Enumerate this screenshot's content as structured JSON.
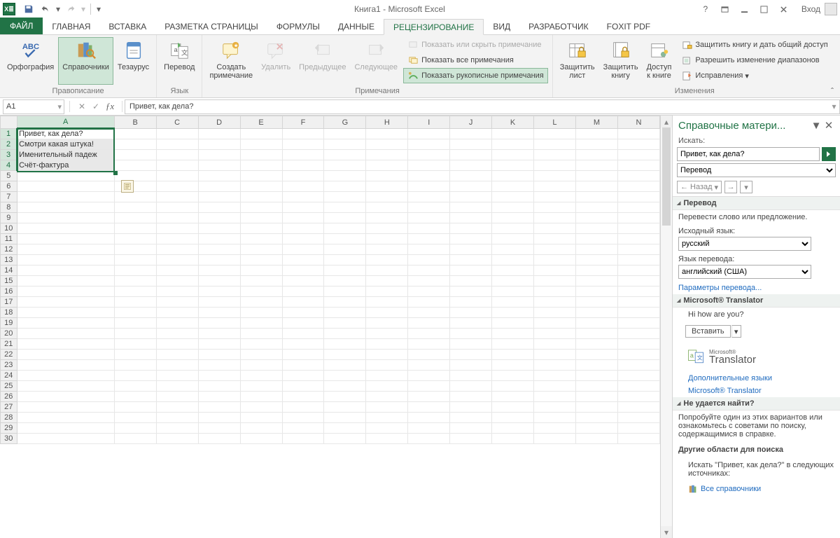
{
  "titlebar": {
    "app_title": "Книга1 - Microsoft Excel",
    "login": "Вход"
  },
  "tabs": {
    "file": "ФАЙЛ",
    "items": [
      "ГЛАВНАЯ",
      "ВСТАВКА",
      "РАЗМЕТКА СТРАНИЦЫ",
      "ФОРМУЛЫ",
      "ДАННЫЕ",
      "РЕЦЕНЗИРОВАНИЕ",
      "ВИД",
      "РАЗРАБОТЧИК",
      "FOXIT PDF"
    ],
    "active_index": 5
  },
  "ribbon": {
    "groups": {
      "proofing": {
        "label": "Правописание",
        "spelling": "Орфография",
        "research": "Справочники",
        "thesaurus": "Тезаурус"
      },
      "language": {
        "label": "Язык",
        "translate": "Перевод"
      },
      "comments": {
        "label": "Примечания",
        "new": "Создать\nпримечание",
        "delete": "Удалить",
        "prev": "Предыдущее",
        "next": "Следующее",
        "show_hide": "Показать или скрыть примечание",
        "show_all": "Показать все примечания",
        "show_ink": "Показать рукописные примечания"
      },
      "changes": {
        "label": "Изменения",
        "protect_sheet": "Защитить\nлист",
        "protect_wb": "Защитить\nкнигу",
        "share": "Доступ\nк книге",
        "protect_share": "Защитить книгу и дать общий доступ",
        "allow_ranges": "Разрешить изменение диапазонов",
        "track": "Исправления"
      }
    }
  },
  "formula_bar": {
    "name_box": "A1",
    "formula": "Привет, как дела?"
  },
  "columns": [
    "A",
    "B",
    "C",
    "D",
    "E",
    "F",
    "G",
    "H",
    "I",
    "J",
    "K",
    "L",
    "M",
    "N"
  ],
  "cells": {
    "A1": "Привет, как дела?",
    "A2": "Смотри какая штука!",
    "A3": "Именительный падеж",
    "A4": "Счёт-фактура"
  },
  "selected_rows": 4,
  "pane": {
    "title": "Справочные матери...",
    "search_label": "Искать:",
    "search_value": "Привет, как дела?",
    "scope": "Перевод",
    "back": "Назад",
    "section_translate": "Перевод",
    "translate_hint": "Перевести слово или предложение.",
    "src_label": "Исходный язык:",
    "src_value": "русский",
    "dst_label": "Язык перевода:",
    "dst_value": "английский (США)",
    "trans_options": "Параметры перевода...",
    "ms_section": "Microsoft® Translator",
    "result": "Hi how are you?",
    "insert": "Вставить",
    "more_langs": "Дополнительные языки",
    "ms_link": "Microsoft® Translator",
    "cant_find": "Не удается найти?",
    "cant_find_text": "Попробуйте один из этих вариантов или ознакомьтесь с советами по поиску, содержащимися в справке.",
    "other_areas": "Другие области для поиска",
    "search_in": "Искать \"Привет, как дела?\" в следующих источниках:",
    "all_refs": "Все справочники",
    "logo_ms": "Microsoft®",
    "logo_tr": "Translator"
  }
}
